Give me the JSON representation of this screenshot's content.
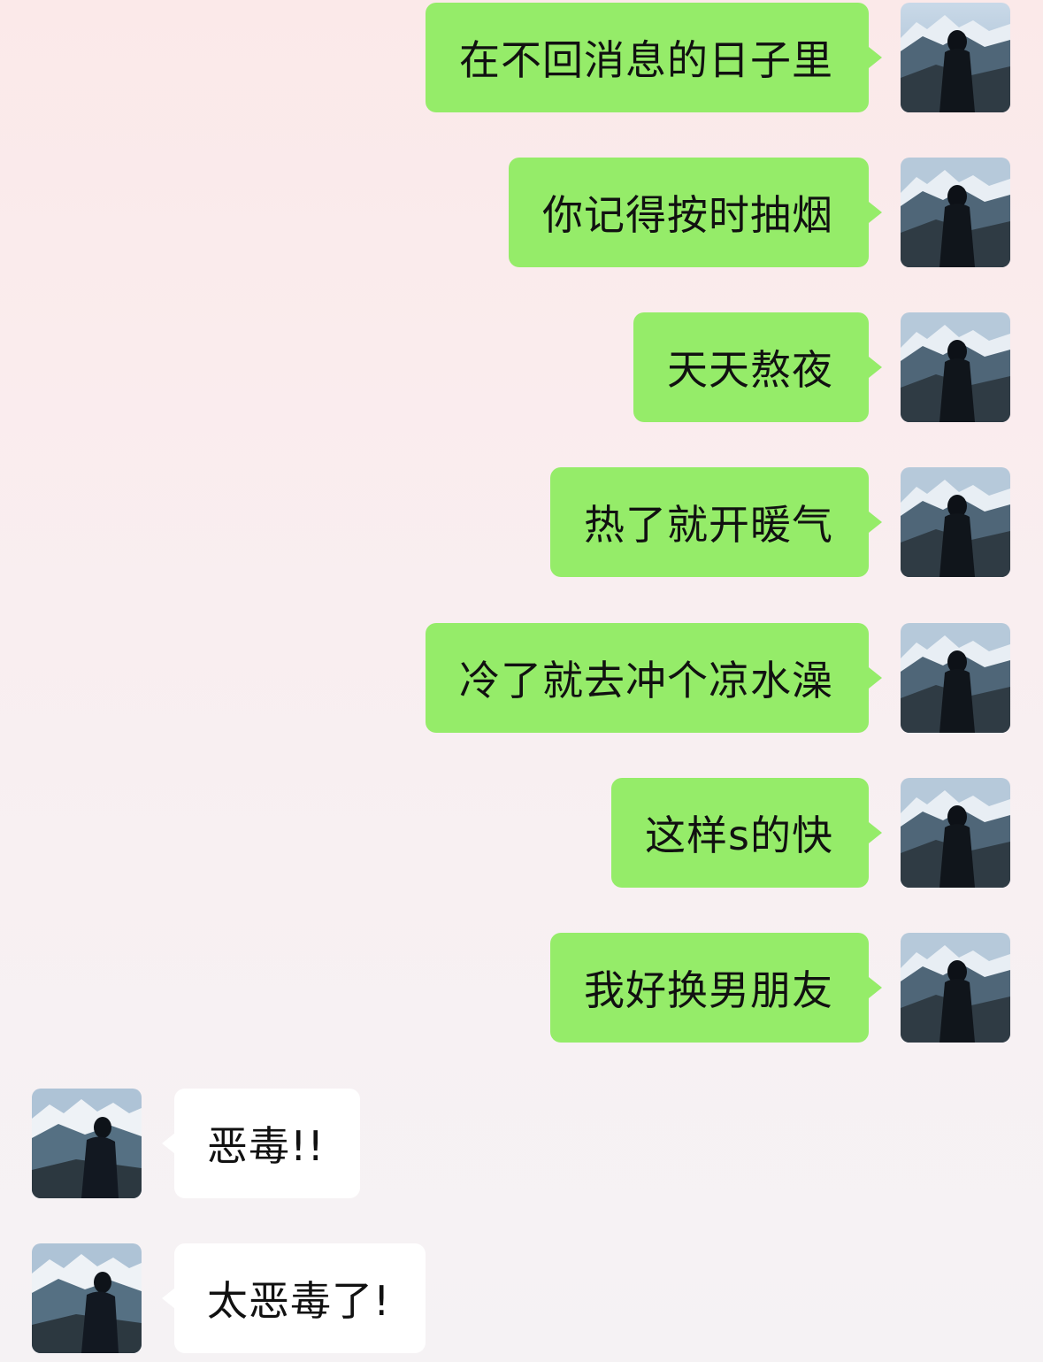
{
  "colors": {
    "outgoing_bubble": "#95ec69",
    "incoming_bubble": "#ffffff",
    "background": "#fbe9e9"
  },
  "messages": [
    {
      "direction": "outgoing",
      "text": "在不回消息的日子里"
    },
    {
      "direction": "outgoing",
      "text": "你记得按时抽烟"
    },
    {
      "direction": "outgoing",
      "text": "天天熬夜"
    },
    {
      "direction": "outgoing",
      "text": "热了就开暖气"
    },
    {
      "direction": "outgoing",
      "text": "冷了就去冲个凉水澡"
    },
    {
      "direction": "outgoing",
      "text": "这样s的快"
    },
    {
      "direction": "outgoing",
      "text": "我好换男朋友"
    },
    {
      "direction": "incoming",
      "text": "恶毒!!"
    },
    {
      "direction": "incoming",
      "text": "太恶毒了!"
    }
  ],
  "avatars": {
    "outgoing": "mountain-girl-avatar",
    "incoming": "mountain-boy-avatar"
  }
}
